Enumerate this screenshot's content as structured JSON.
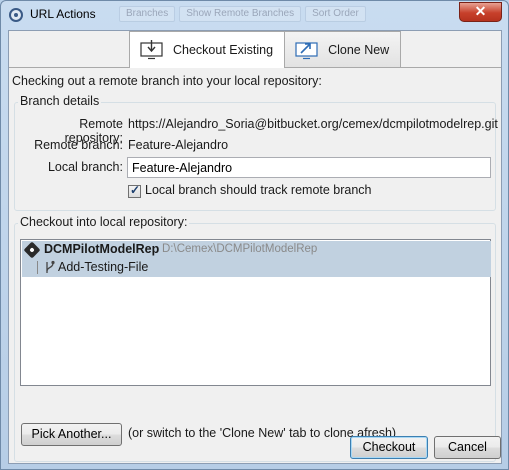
{
  "window": {
    "title": "URL Actions",
    "close_glyph": "✕",
    "background_toolbar": [
      "Branches",
      "Show Remote Branches",
      "Sort Order"
    ]
  },
  "tabs": [
    {
      "label": "Checkout Existing",
      "icon": "monitor-download-icon",
      "active": true
    },
    {
      "label": "Clone New",
      "icon": "monitor-clone-icon",
      "active": false
    }
  ],
  "intro_text": "Checking out a remote branch into your local repository:",
  "branch_details": {
    "group_label": "Branch details",
    "remote_repo_label": "Remote repository:",
    "remote_repo_value": "https://Alejandro_Soria@bitbucket.org/cemex/dcmpilotmodelrep.git",
    "remote_branch_label": "Remote branch:",
    "remote_branch_value": "Feature-Alejandro",
    "local_branch_label": "Local branch:",
    "local_branch_value": "Feature-Alejandro",
    "track_label": "Local branch should track remote branch",
    "track_checked": true
  },
  "checkout_into": {
    "group_label": "Checkout into local repository:",
    "repo_name": "DCMPilotModelRep",
    "repo_path": "D:\\Cemex\\DCMPilotModelRep",
    "branch_name": "Add-Testing-File",
    "pick_another_label": "Pick Another...",
    "hint": "(or switch to the 'Clone New' tab to clone afresh)"
  },
  "footer": {
    "checkout_label": "Checkout",
    "cancel_label": "Cancel"
  },
  "colors": {
    "selection": "#c1d1e0",
    "title_frame": "#b9d1ea",
    "close": "#c7402b",
    "icon_blue": "#2d6cb5"
  }
}
